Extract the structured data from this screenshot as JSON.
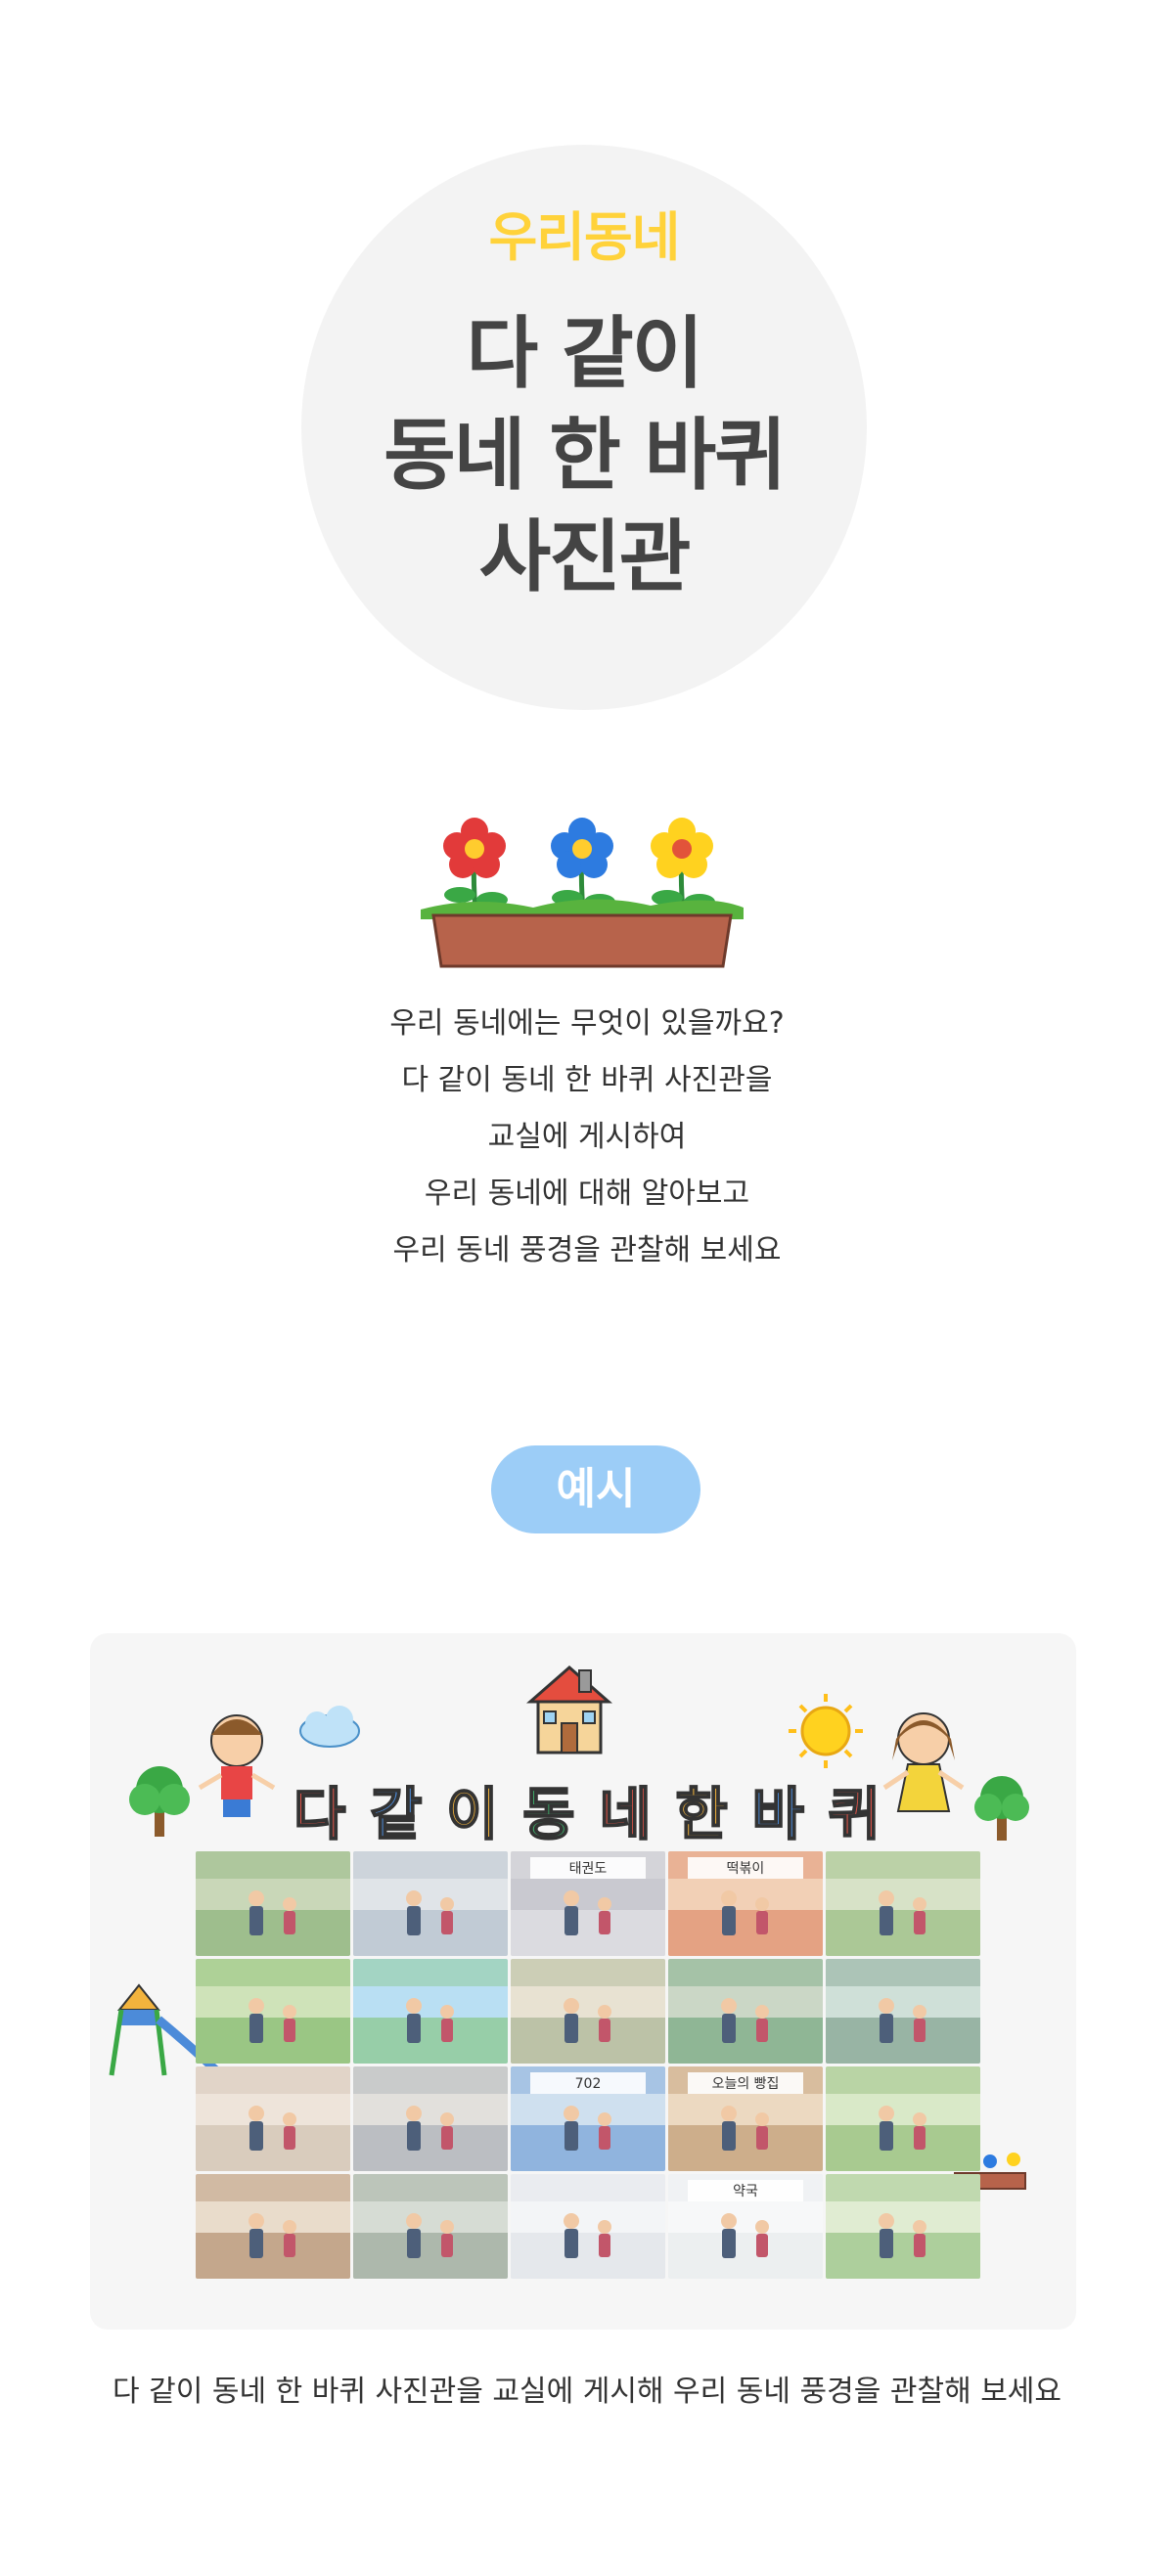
{
  "hero": {
    "tag": "우리동네",
    "title_lines": [
      "다 같이",
      "동네 한 바퀴",
      "사진관"
    ]
  },
  "intro": {
    "lines": [
      "우리 동네에는 무엇이 있을까요?",
      "다 같이 동네 한 바퀴 사진관을",
      "교실에 게시하여",
      "우리 동네에 대해 알아보고",
      "우리 동네 풍경을 관찰해 보세요"
    ]
  },
  "example": {
    "label": "예시",
    "banner_chars": [
      "다",
      "같",
      "이",
      "동",
      "네",
      "한",
      "바",
      "퀴"
    ],
    "banner_colors": [
      "#e9564b",
      "#4c8bd9",
      "#f2b33d",
      "#3fae6b",
      "#e9564b",
      "#f2b33d",
      "#4c8bd9",
      "#e9564b"
    ],
    "photo_signs": {
      "taekwondo": "태권도",
      "tteokbokki": "떡볶이",
      "bus": "702",
      "bakery": "오늘의 빵집",
      "pharmacy": "약국"
    },
    "photo_icons": [
      "exercise-photo",
      "crosswalk-photo",
      "taekwondo-photo",
      "tteokbokki-photo",
      "grandparents-photo",
      "park-family-photo",
      "swing-photo",
      "market-photo",
      "recycling-photo",
      "subway-station-photo",
      "barbershop-photo",
      "delivery-photo",
      "bus-photo",
      "bakery-photo",
      "walk-dog-photo",
      "flower-shop-photo",
      "street-cleaner-photo",
      "clinic-photo",
      "pharmacy-photo",
      "bicycle-photo"
    ]
  },
  "caption": "다 같이 동네 한 바퀴 사진관을 교실에 게시해 우리 동네 풍경을 관찰해 보세요"
}
